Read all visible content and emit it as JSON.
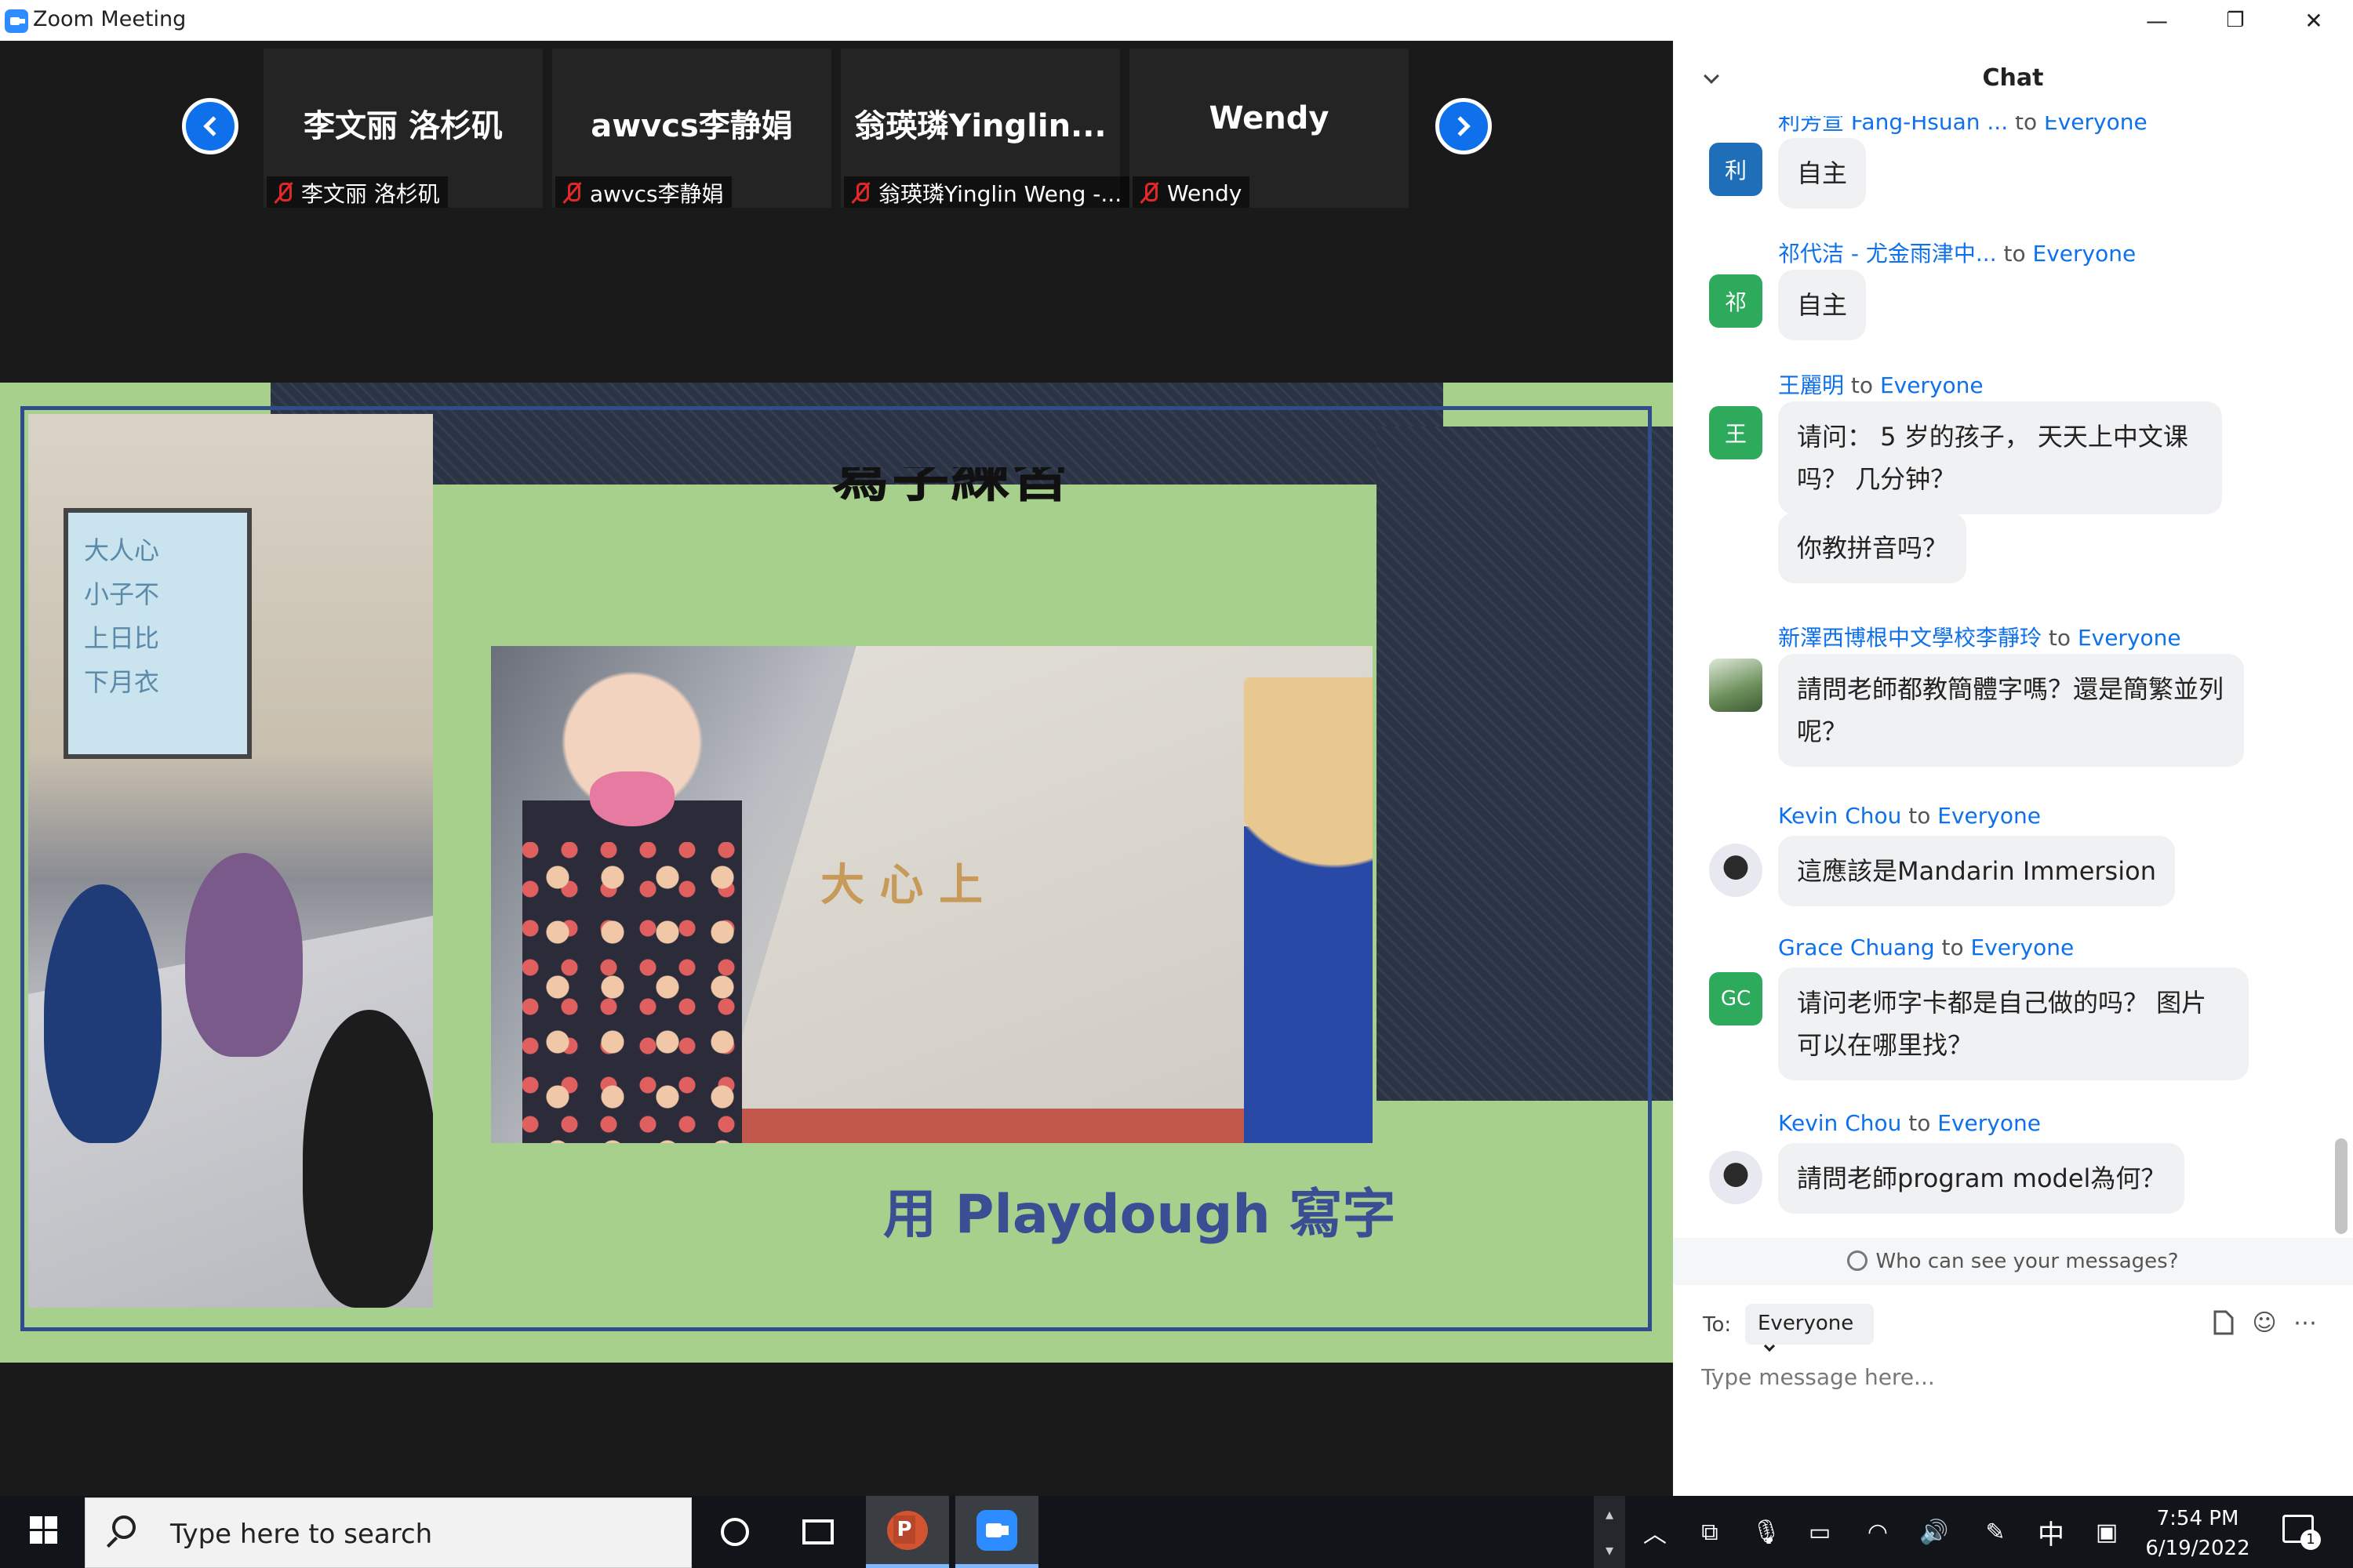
{
  "window": {
    "title": "Zoom Meeting",
    "minimize": "—",
    "restore": "❐",
    "close": "✕"
  },
  "gallery": {
    "participants": [
      {
        "display_name": "李文丽 洛杉矶",
        "tag": "李文丽 洛杉矶"
      },
      {
        "display_name": "awvcs李静娟",
        "tag": "awvcs李静娟"
      },
      {
        "display_name": "翁瑛璘Yinglin...",
        "tag": "翁瑛璘Yinglin Weng -..."
      },
      {
        "display_name": "Wendy",
        "tag": "Wendy"
      }
    ]
  },
  "slide": {
    "heading_top": "寫字練習",
    "caption": "用 Playdough 寫字",
    "board_chars": "大人心\n小子不\n上日比\n下月衣",
    "desk_letters": "大 心 上"
  },
  "chat": {
    "title": "Chat",
    "messages": [
      {
        "sender": "利芳宣 Fang-Hsuan ...",
        "to": "to",
        "recipient": "Everyone",
        "avatar": "利",
        "avatar_color": "#1f6fb8",
        "bubbles": [
          "自主"
        ]
      },
      {
        "sender": "祁代洁 - 尤金雨津中...",
        "to": "to",
        "recipient": "Everyone",
        "avatar": "祁",
        "avatar_color": "#2eaa5c",
        "bubbles": [
          "自主"
        ]
      },
      {
        "sender": "王麗明",
        "to": "to",
        "recipient": "Everyone",
        "avatar": "王",
        "avatar_color": "#2eaa5c",
        "bubbles": [
          "请问： 5 岁的孩子， 天天上中文课吗？ 几分钟？",
          "你教拼音吗？"
        ]
      },
      {
        "sender": "新澤西博根中文學校李靜玲",
        "to": "to",
        "recipient": "Everyone",
        "avatar": "",
        "avatar_color": "#6b8e5a",
        "bubbles": [
          "請問老師都教簡體字嗎？還是簡繁並列呢？"
        ]
      },
      {
        "sender": "Kevin Chou",
        "to": "to",
        "recipient": "Everyone",
        "avatar": "",
        "avatar_color": "#ffffff",
        "bubbles": [
          "這應該是Mandarin Immersion"
        ]
      },
      {
        "sender": "Grace Chuang",
        "to": "to",
        "recipient": "Everyone",
        "avatar": "GC",
        "avatar_color": "#2eaa5c",
        "bubbles": [
          "请问老师字卡都是自己做的吗？ 图片可以在哪里找？"
        ]
      },
      {
        "sender": "Kevin Chou",
        "to": "to",
        "recipient": "Everyone",
        "avatar": "",
        "avatar_color": "#ffffff",
        "bubbles": [
          "請問老師program model為何？"
        ]
      }
    ],
    "privacy_link": "Who can see your messages?",
    "composer": {
      "to_label": "To:",
      "recipient": "Everyone",
      "placeholder": "Type message here..."
    }
  },
  "taskbar": {
    "search_placeholder": "Type here to search",
    "ime": "中",
    "time": "7:54 PM",
    "date": "6/19/2022",
    "notification_count": "1"
  }
}
